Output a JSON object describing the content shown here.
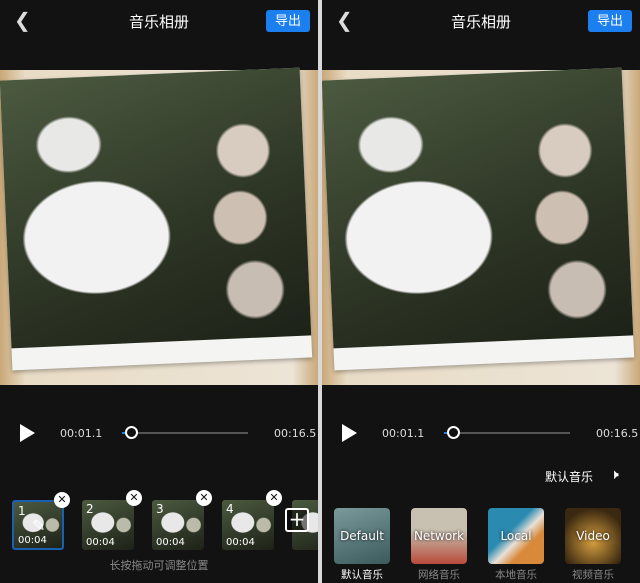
{
  "header": {
    "title": "音乐相册",
    "export_label": "导出"
  },
  "player": {
    "current_time": "00:01.1",
    "total_time": "00:16.5",
    "progress_percent": 7
  },
  "clips": [
    {
      "index": "1",
      "duration": "00:04",
      "selected": true
    },
    {
      "index": "2",
      "duration": "00:04"
    },
    {
      "index": "3",
      "duration": "00:04"
    },
    {
      "index": "4",
      "duration": "00:04"
    }
  ],
  "hint": "长按拖动可调整位置",
  "music": {
    "current": "默认音乐",
    "cards": [
      {
        "title": "Default",
        "label": "默认音乐",
        "active": true
      },
      {
        "title": "Network",
        "label": "网络音乐"
      },
      {
        "title": "Local",
        "label": "本地音乐"
      },
      {
        "title": "Video",
        "label": "视频音乐"
      }
    ]
  },
  "colors": {
    "accent": "#1b7ff0"
  }
}
